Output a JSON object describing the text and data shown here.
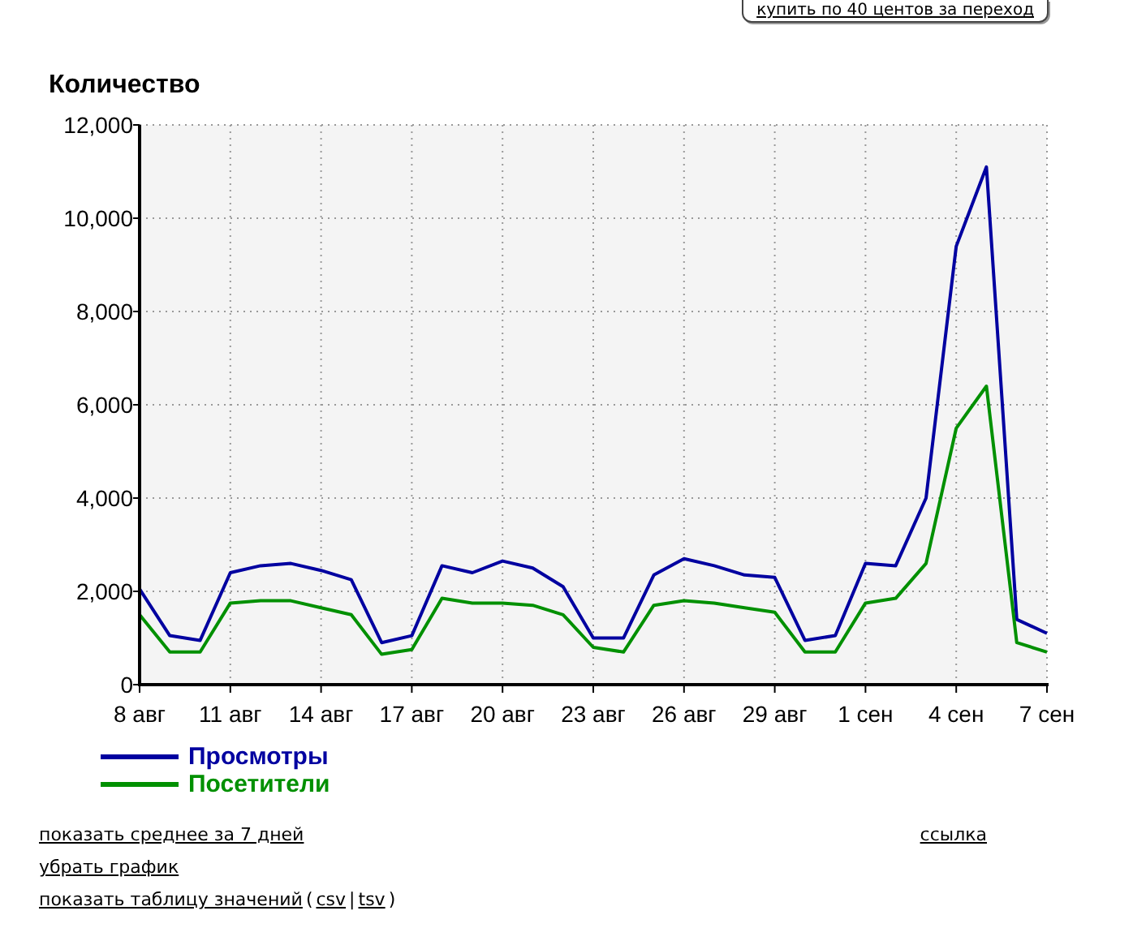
{
  "buy_button": {
    "label": "купить по 40 центов за переход"
  },
  "chart": {
    "chart_data": {
      "type": "line",
      "ylabel": "Количество",
      "categories": [
        "8 авг",
        null,
        null,
        "11 авг",
        null,
        null,
        "14 авг",
        null,
        null,
        "17 авг",
        null,
        null,
        "20 авг",
        null,
        null,
        "23 авг",
        null,
        null,
        "26 авг",
        null,
        null,
        "29 авг",
        null,
        null,
        "1 сен",
        null,
        null,
        "4 сен",
        null,
        null,
        "7 сен"
      ],
      "series": [
        {
          "name": "Просмотры",
          "color": "#0000a0",
          "values": [
            2050,
            1050,
            950,
            2400,
            2550,
            2600,
            2450,
            2250,
            900,
            1050,
            2550,
            2400,
            2650,
            2500,
            2100,
            1000,
            1000,
            2350,
            2700,
            2550,
            2350,
            2300,
            950,
            1050,
            2600,
            2550,
            4000,
            9400,
            11100,
            1400,
            1100
          ]
        },
        {
          "name": "Посетители",
          "color": "#009000",
          "values": [
            1500,
            700,
            700,
            1750,
            1800,
            1800,
            1650,
            1500,
            650,
            750,
            1850,
            1750,
            1750,
            1700,
            1500,
            800,
            700,
            1700,
            1800,
            1750,
            1650,
            1550,
            700,
            700,
            1750,
            1850,
            2600,
            5500,
            6400,
            900,
            700
          ]
        }
      ],
      "ylim": [
        0,
        12000
      ],
      "grid": true,
      "legend": "bottom",
      "yticks": [
        {
          "value": 0,
          "label": "0"
        },
        {
          "value": 2000,
          "label": "2,000"
        },
        {
          "value": 4000,
          "label": "4,000"
        },
        {
          "value": 6000,
          "label": "6,000"
        },
        {
          "value": 8000,
          "label": "8,000"
        },
        {
          "value": 10000,
          "label": "10,000"
        },
        {
          "value": 12000,
          "label": "12,000"
        }
      ]
    }
  },
  "links": [
    {
      "parts": [
        {
          "kind": "link",
          "text": "показать среднее за 7 дней"
        }
      ]
    },
    {
      "parts": [
        {
          "kind": "link",
          "text": "убрать график"
        }
      ]
    },
    {
      "parts": [
        {
          "kind": "link",
          "text": "показать таблицу значений"
        },
        {
          "kind": "text",
          "text": "("
        },
        {
          "kind": "link",
          "text": "csv"
        },
        {
          "kind": "text",
          "text": "|"
        },
        {
          "kind": "link",
          "text": "tsv"
        },
        {
          "kind": "text",
          "text": ")"
        }
      ]
    }
  ],
  "share_link": {
    "text": "ссылка"
  }
}
